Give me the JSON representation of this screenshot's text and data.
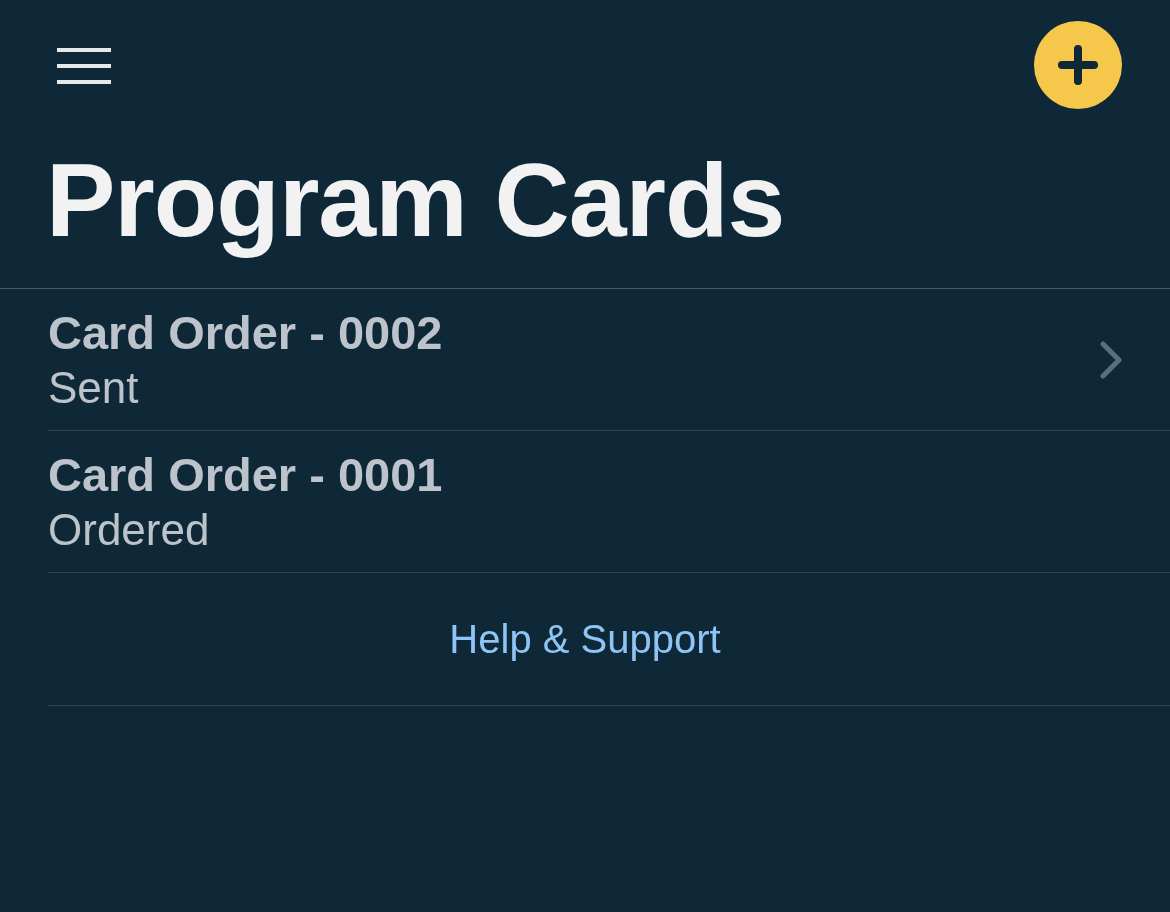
{
  "header": {
    "title": "Program Cards"
  },
  "orders": [
    {
      "title": "Card Order - 0002",
      "status": "Sent",
      "chevron": true
    },
    {
      "title": "Card Order - 0001",
      "status": "Ordered",
      "chevron": false
    }
  ],
  "help_link": {
    "label": "Help & Support"
  }
}
